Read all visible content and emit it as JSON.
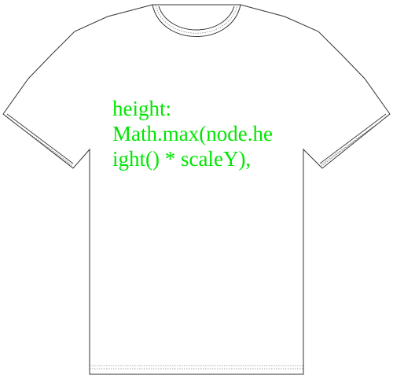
{
  "shirt": {
    "fill_color": "#ffffff",
    "outline_color": "#333333"
  },
  "print": {
    "color": "#00e600",
    "lines": [
      "height:",
      "Math.max(node.he",
      "ight() * scaleY),"
    ]
  }
}
